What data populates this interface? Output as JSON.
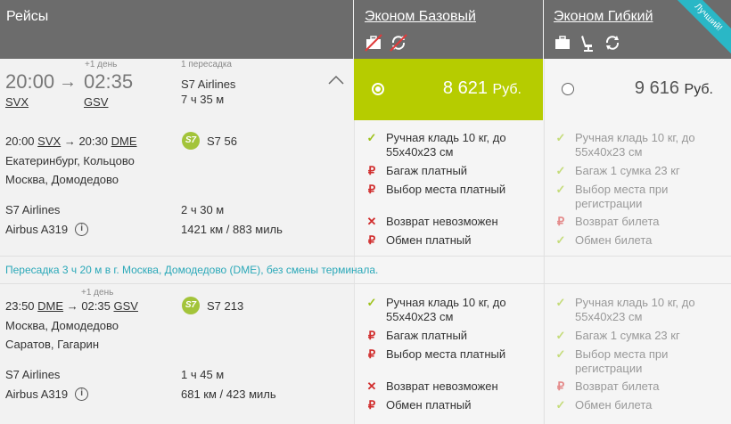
{
  "header": {
    "flights": "Рейсы",
    "econ_base": "Эконом Базовый",
    "econ_flex": "Эконом Гибкий",
    "best": "Лучший!"
  },
  "summary": {
    "dep_time": "20:00",
    "arr_time": "02:35",
    "dep_code": "SVX",
    "arr_code": "GSV",
    "plus_day": "+1 день",
    "stops": "1 пересадка",
    "airline": "S7 Airlines",
    "duration": "7 ч 35 м"
  },
  "prices": {
    "base": "8 621",
    "flex": "9 616",
    "currency": "Руб."
  },
  "segment1": {
    "dep_time": "20:00",
    "dep_code": "SVX",
    "arr_time": "20:30",
    "arr_code": "DME",
    "from": "Екатеринбург, Кольцово",
    "to": "Москва, Домодедово",
    "flight": "S7 56",
    "airline": "S7 Airlines",
    "aircraft": "Airbus A319",
    "duration": "2 ч 30 м",
    "distance": "1421 км / 883 миль"
  },
  "transfer": "Пересадка 3 ч 20 м в г. Москва, Домодедово (DME), без смены терминала.",
  "segment2": {
    "dep_time": "23:50",
    "dep_code": "DME",
    "arr_time": "02:35",
    "arr_code": "GSV",
    "plus_day": "+1 день",
    "from": "Москва, Домодедово",
    "to": "Саратов, Гагарин",
    "flight": "S7 213",
    "airline": "S7 Airlines",
    "aircraft": "Airbus A319",
    "duration": "1 ч 45 м",
    "distance": "681 км / 423 миль"
  },
  "features_base": {
    "hand": "Ручная кладь 10 кг, до",
    "hand2": "55x40x23 см",
    "bag": "Багаж платный",
    "seat": "Выбор места платный",
    "refund": "Возврат невозможен",
    "change": "Обмен платный"
  },
  "features_flex": {
    "hand": "Ручная кладь 10 кг, до",
    "hand2": "55x40x23 см",
    "bag": "Багаж 1 сумка 23 кг",
    "seat": "Выбор места при",
    "seat2": "регистрации",
    "refund": "Возврат билета",
    "change": "Обмен билета"
  },
  "icons": {
    "ok": "✓",
    "paid": "₽",
    "no": "✕",
    "arrow": "→",
    "info": "i",
    "s7": "S7"
  },
  "colors": {
    "header_bg": "#6c6c6c",
    "selected_price_bg": "#b6cc00",
    "ribbon": "#2ab7c6",
    "check_green": "#9ec21c",
    "paid_red": "#d12d2d",
    "transfer_text": "#2aa8b8"
  }
}
